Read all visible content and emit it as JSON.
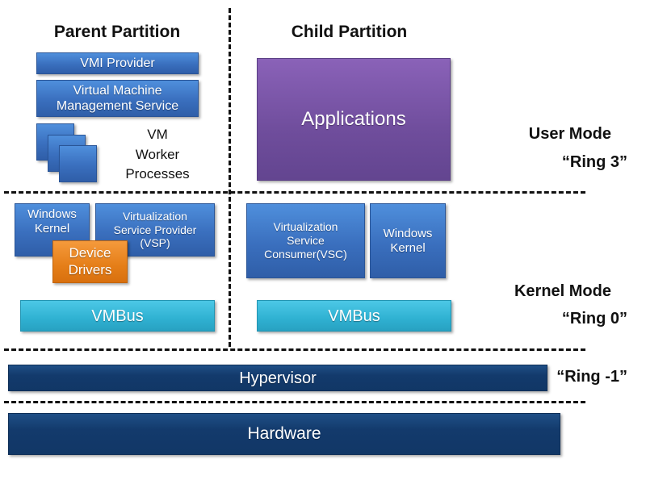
{
  "headings": {
    "parent": "Parent Partition",
    "child": "Child Partition"
  },
  "parent": {
    "vmi_provider": "VMI Provider",
    "vmms": "Virtual Machine\nManagement Service",
    "worker_label": [
      "VM",
      "Worker",
      "Processes"
    ],
    "windows_kernel": "Windows\nKernel",
    "vsp": "Virtualization\nService Provider\n(VSP)",
    "device_drivers": "Device\nDrivers",
    "vmbus": "VMBus"
  },
  "child": {
    "applications": "Applications",
    "vsc": "Virtualization\nService\nConsumer(VSC)",
    "windows_kernel": "Windows\nKernel",
    "vmbus": "VMBus"
  },
  "layers": {
    "hypervisor": "Hypervisor",
    "hardware": "Hardware"
  },
  "modes": {
    "user_mode": "User Mode",
    "ring3": "“Ring 3”",
    "kernel_mode": "Kernel Mode",
    "ring0": "“Ring 0”",
    "ring_minus1": "“Ring -1”"
  },
  "colors": {
    "blue": "#3a6fbe",
    "purple": "#6f4d9c",
    "orange": "#e57e18",
    "cyan": "#2fb1d2",
    "navy": "#133a6c"
  }
}
